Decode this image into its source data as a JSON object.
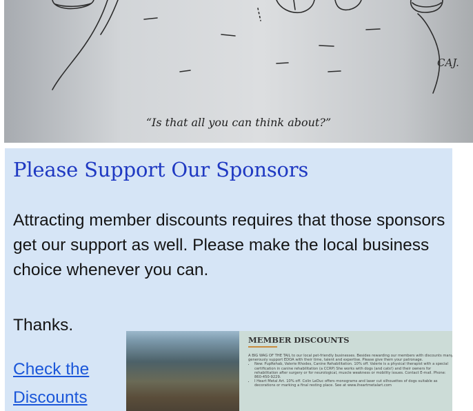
{
  "cartoon": {
    "caption": "“Is that all you can think about?”",
    "signature": "CAJ."
  },
  "sponsors": {
    "title": "Please Support Our Sponsors",
    "body": "Attracting member discounts requires that those sponsors get our support as well.  Please make the local business choice whenever you can.",
    "thanks": "Thanks.",
    "link_text": "Check the Discounts"
  },
  "discounts_thumb": {
    "heading": "MEMBER DISCOUNTS",
    "intro": "A BIG WAG OF THE TAIL to our local pet-friendly businesses.  Besides rewarding our members with discounts many generously support EDOA with their time, talent and expertise. Please give them your patronage.",
    "items": [
      "New: PupRehab, Valerie Rhodes, Canine Rehabilitation.  10% off. Valerie is a physical therapist with a special certification in canine rehabilitation (a CCRP) She works with dogs (and cats!) and their owners for rehabilitation after surgery or for neurological, muscle weakness or mobility issues. Contact E-mail. Phone: 860-450-9229.",
      "I Heart Metal Art.  10% off. Colin LeDuc offers monograms and laser cut silhouettes of dogs suitable as decorations or marking a final resting place. See at www.iheartmetalart.com"
    ]
  }
}
